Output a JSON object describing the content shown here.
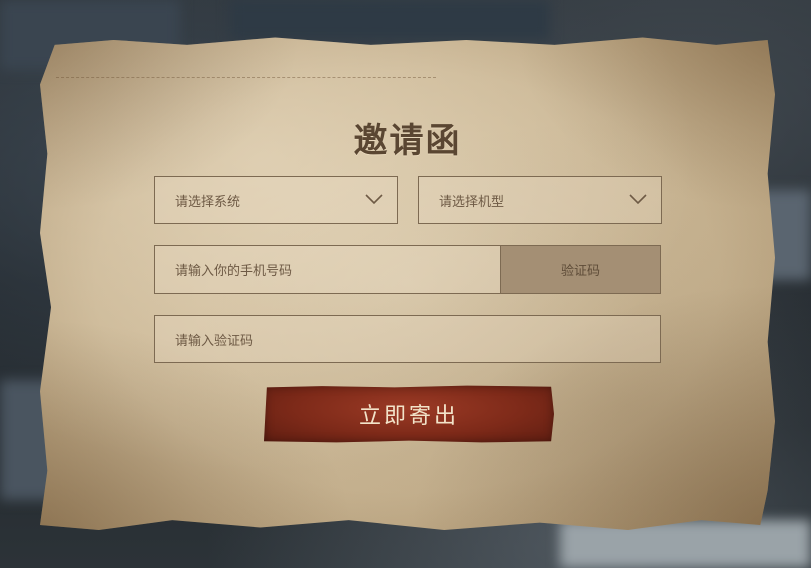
{
  "form": {
    "title": "邀请函",
    "system_select": {
      "placeholder": "请选择系统"
    },
    "model_select": {
      "placeholder": "请选择机型"
    },
    "phone": {
      "placeholder": "请输入你的手机号码",
      "code_button_label": "验证码"
    },
    "verify_code": {
      "placeholder": "请输入验证码"
    },
    "submit_label": "立即寄出"
  },
  "icons": {
    "dropdown": "chevron-down-icon"
  },
  "colors": {
    "paper": "#c9b593",
    "border": "#7d6a52",
    "title": "#5a4632",
    "code_button_bg": "#a48f74",
    "submit_bg": "#7e2a19",
    "submit_text": "#f2e3c9"
  }
}
